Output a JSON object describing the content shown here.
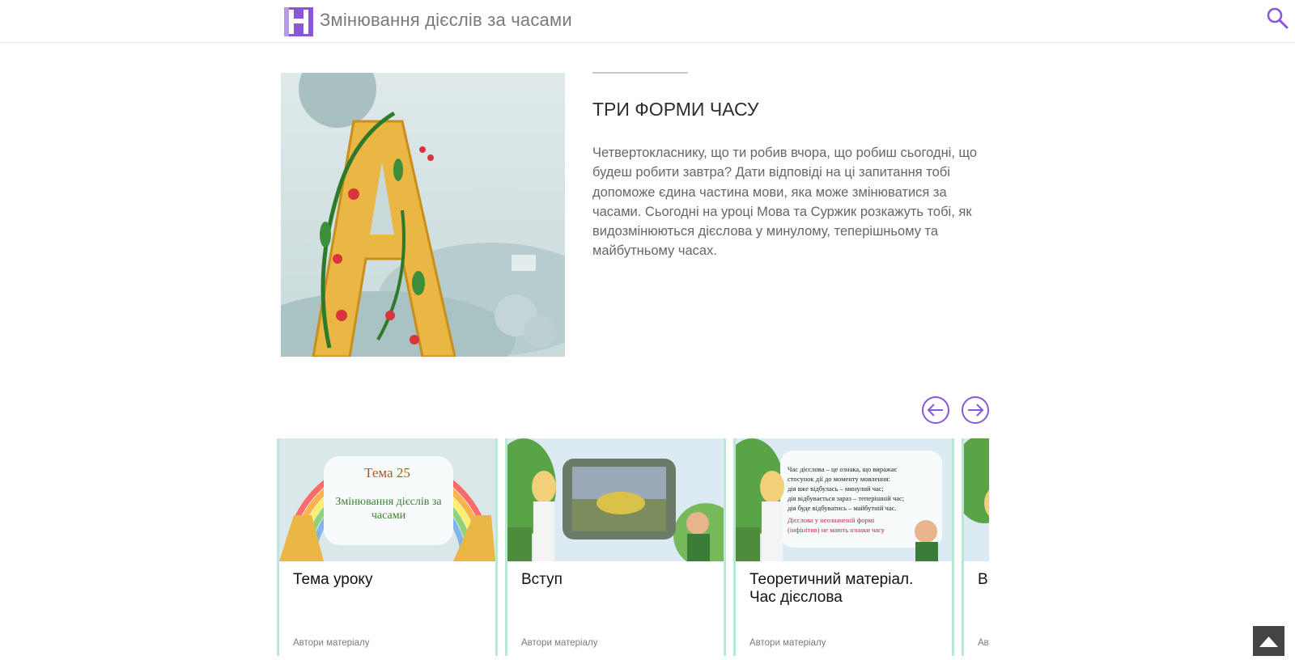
{
  "header": {
    "title": "Змінювання дієслів за часами",
    "logo_icon": "hromadske-logo-icon",
    "search_icon": "search-icon",
    "accent_color": "#8a57d8"
  },
  "lesson": {
    "heading": "ТРИ ФОРМИ ЧАСУ",
    "description": "Четвертокласнику, що ти робив вчора, що робиш сьогодні, що будеш робити завтра? Дати відповіді на ці запитання тобі допоможе єдина частина мови, яка може змінюватися за часами. Сьогодні на уроці Мова та Суржик розкажуть тобі, як видозмінюються дієслова у минулому, теперішньому та майбутньому часах."
  },
  "carousel": {
    "prev_icon": "arrow-left-circle-icon",
    "next_icon": "arrow-right-circle-icon",
    "cards": [
      {
        "title": "Тема уроку",
        "authors": "Автори матеріалу",
        "thumb_topic": "Тема 25",
        "thumb_caption": "Змінювання дієслів за часами"
      },
      {
        "title": "Вступ",
        "authors": "Автори матеріалу"
      },
      {
        "title": "Теоретичний матеріал. Час дієслова",
        "authors": "Автори матеріалу",
        "thumb_lines": [
          "Час дієслова – це ознака, що виражає",
          "стосунок дії до моменту мовлення:",
          "дія вже відбулась – минулий час;",
          "дія відбувається зараз – теперішній час;",
          "дія буде відбуватись – майбутній час.",
          "Дієслова у неозначеній формі",
          "(інфінітив) не мають ознаки часу"
        ]
      },
      {
        "title": "Вправа",
        "authors": "Автори матеріалу"
      }
    ]
  },
  "scroll_top_icon": "chevron-up-icon"
}
